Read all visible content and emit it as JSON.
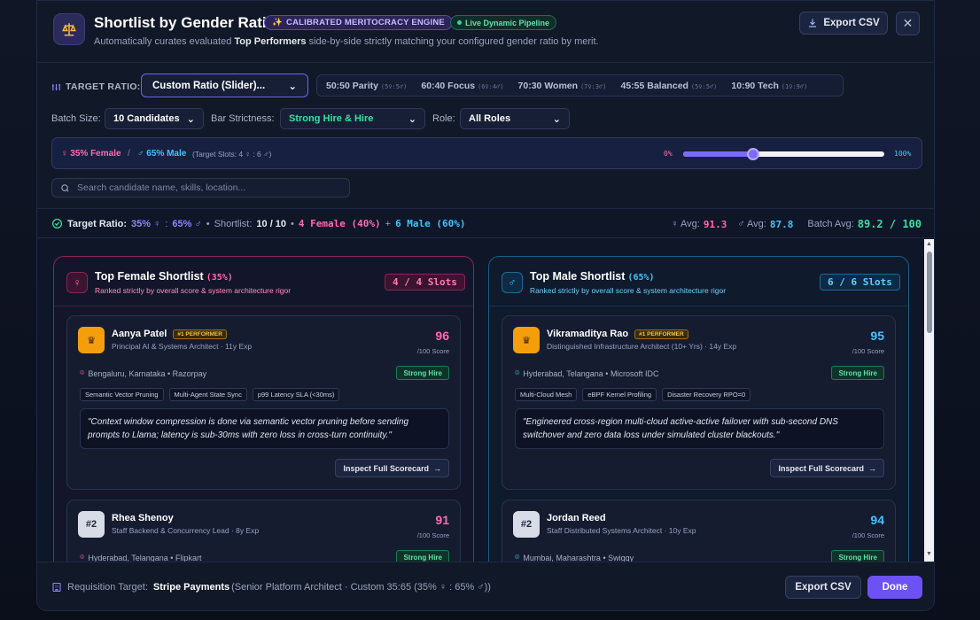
{
  "header": {
    "title": "Shortlist by Gender Ratio",
    "engine_badge": "CALIBRATED MERITOCRACY ENGINE",
    "live_badge": "Live Dynamic Pipeline",
    "subtitle_pre": "Automatically curates evaluated ",
    "subtitle_bold": "Top Performers",
    "subtitle_post": " side-by-side strictly matching your configured gender ratio by merit.",
    "export_label": "Export CSV",
    "close_glyph": "✕"
  },
  "controls": {
    "target_ratio_label": "TARGET RATIO:",
    "ratio_select_value": "Custom Ratio (Slider)...",
    "presets": [
      {
        "label": "50:50 Parity",
        "code": "(5♀:5♂)"
      },
      {
        "label": "60:40 Focus",
        "code": "(6♀:4♂)"
      },
      {
        "label": "70:30 Women",
        "code": "(7♀:3♂)"
      },
      {
        "label": "45:55 Balanced",
        "code": "(5♀:5♂)"
      },
      {
        "label": "10:90 Tech",
        "code": "(1♀:9♂)"
      }
    ],
    "batch_size_label": "Batch Size:",
    "batch_size_value": "10 Candidates",
    "bar_strictness_label": "Bar Strictness:",
    "bar_strictness_value": "Strong Hire & Hire",
    "role_label": "Role:",
    "role_value": "All Roles",
    "slider": {
      "female_text": "♀ 35% Female",
      "separator": "/",
      "male_text": "♂ 65% Male",
      "slots_text": "(Target Slots: 4 ♀ : 6 ♂)",
      "min_label": "0%",
      "max_label": "100%",
      "value_fraction": 0.35
    },
    "search_placeholder": "Search candidate name, skills, location..."
  },
  "summary": {
    "target_label": "Target Ratio:",
    "target_value_f": "35% ♀",
    "target_colon": ":",
    "target_value_m": "65% ♂",
    "bullet": "•",
    "shortlist_label": "Shortlist:",
    "shortlist_value": "10 / 10",
    "female_count": "4 Female (40%)",
    "plus": "+",
    "male_count": "6 Male (60%)",
    "f_avg_label": "♀ Avg:",
    "f_avg_value": "91.3",
    "m_avg_label": "♂ Avg:",
    "m_avg_value": "87.8",
    "batch_avg_label": "Batch Avg:",
    "batch_avg_value": "89.2 / 100"
  },
  "female_column": {
    "title": "Top Female Shortlist",
    "pct": "(35%)",
    "subtitle": "Ranked strictly by overall score & system architecture rigor",
    "slots": "4 / 4 Slots",
    "cards": [
      {
        "rank": "♛",
        "name": "Aanya Patel",
        "badge": "#1 PERFORMER",
        "role": "Principal AI & Systems Architect · 11y Exp",
        "score": "96",
        "score_sub": "/100 Score",
        "location": "Bengaluru, Karnataka • Razorpay",
        "verdict": "Strong Hire",
        "tags": [
          "Semantic Vector Pruning",
          "Multi-Agent State Sync",
          "p99 Latency SLA (<30ms)"
        ],
        "quote": "\"Context window compression is done via semantic vector pruning before sending prompts to Llama; latency is sub-30ms with zero loss in cross-turn continuity.\"",
        "inspect": "Inspect Full Scorecard"
      },
      {
        "rank": "#2",
        "name": "Rhea Shenoy",
        "role": "Staff Backend & Concurrency Lead · 8y Exp",
        "score": "91",
        "score_sub": "/100 Score",
        "location": "Hyderabad, Telangana • Flipkart",
        "verdict": "Strong Hire"
      }
    ]
  },
  "male_column": {
    "title": "Top Male Shortlist",
    "pct": "(65%)",
    "subtitle": "Ranked strictly by overall score & system architecture rigor",
    "slots": "6 / 6 Slots",
    "cards": [
      {
        "rank": "♛",
        "name": "Vikramaditya Rao",
        "badge": "#1 PERFORMER",
        "role": "Distinguished Infrastructure Architect (10+ Yrs) · 14y Exp",
        "score": "95",
        "score_sub": "/100 Score",
        "location": "Hyderabad, Telangana • Microsoft IDC",
        "verdict": "Strong Hire",
        "tags": [
          "Multi-Cloud Mesh",
          "eBPF Kernel Profiling",
          "Disaster Recovery RPO=0"
        ],
        "quote": "\"Engineered cross-region multi-cloud active-active failover with sub-second DNS switchover and zero data loss under simulated cluster blackouts.\"",
        "inspect": "Inspect Full Scorecard"
      },
      {
        "rank": "#2",
        "name": "Jordan Reed",
        "role": "Staff Distributed Systems Architect · 10y Exp",
        "score": "94",
        "score_sub": "/100 Score",
        "location": "Mumbai, Maharashtra • Swiggy",
        "verdict": "Strong Hire"
      }
    ]
  },
  "footer": {
    "req_label": "Requisition Target:",
    "req_company": "Stripe Payments",
    "req_detail": "(Senior Platform Architect · Custom 35:65 (35% ♀ : 65% ♂))",
    "export_label": "Export CSV",
    "done_label": "Done"
  },
  "colors": {
    "accent": "#6c52f5",
    "female": "#ff6ab0",
    "male": "#3fc4ff",
    "success": "#34e0a1"
  }
}
